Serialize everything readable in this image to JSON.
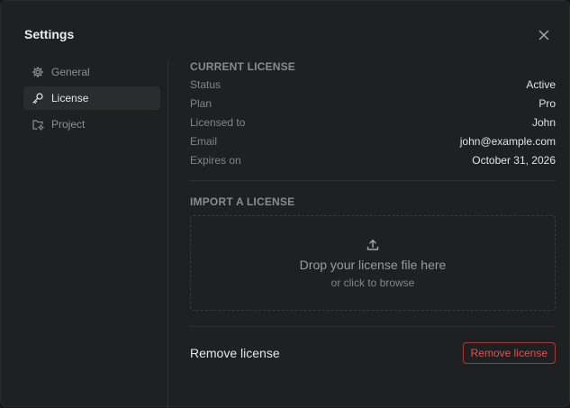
{
  "dialog": {
    "title": "Settings",
    "close_icon": "close-icon"
  },
  "sidebar": {
    "items": [
      {
        "label": "General",
        "icon": "gear-icon",
        "active": false
      },
      {
        "label": "License",
        "icon": "key-icon",
        "active": true
      },
      {
        "label": "Project",
        "icon": "folder-settings-icon",
        "active": false
      }
    ]
  },
  "current_license": {
    "heading": "CURRENT LICENSE",
    "rows": [
      {
        "label": "Status",
        "value": "Active"
      },
      {
        "label": "Plan",
        "value": "Pro"
      },
      {
        "label": "Licensed to",
        "value": "John"
      },
      {
        "label": "Email",
        "value": "john@example.com"
      },
      {
        "label": "Expires on",
        "value": "October 31, 2026"
      }
    ]
  },
  "import_license": {
    "heading": "IMPORT A LICENSE",
    "dropzone_icon": "upload-icon",
    "dropzone_title": "Drop your license file here",
    "dropzone_subtitle": "or click to browse"
  },
  "remove": {
    "label": "Remove license",
    "button_label": "Remove license",
    "button_color": "#e05252"
  },
  "colors": {
    "accent_danger": "#e05252",
    "background": "#1f2022"
  }
}
